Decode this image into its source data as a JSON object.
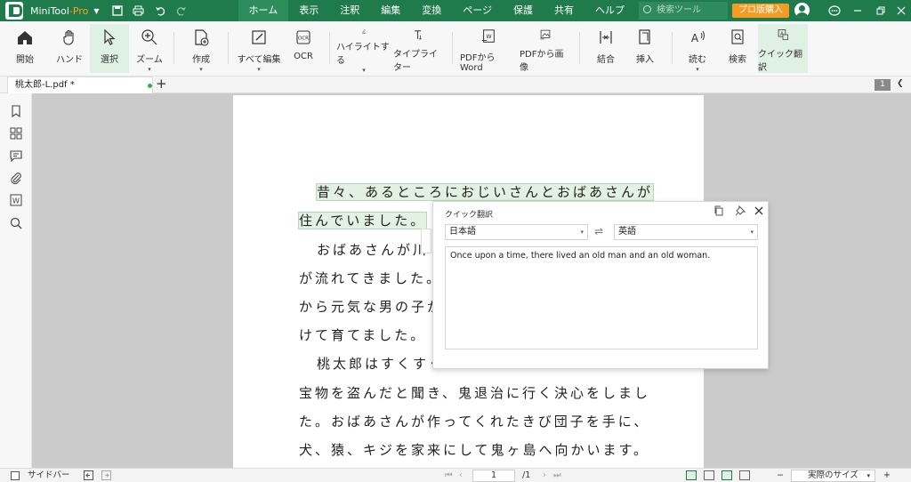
{
  "titlebar": {
    "app_name": "MiniTool",
    "app_suffix": "-Pro",
    "menu": [
      "ホーム",
      "表示",
      "注釈",
      "編集",
      "変換",
      "ページ",
      "保護",
      "共有",
      "ヘルプ"
    ],
    "search_placeholder": "検索ツール",
    "buy_label": "プロ版購入"
  },
  "ribbon": {
    "open": "開始",
    "hand": "ハンド",
    "select": "選択",
    "zoom": "ズーム",
    "create": "作成",
    "edit_all": "すべて編集",
    "ocr": "OCR",
    "highlight": "ハイライトする",
    "typewriter": "タイプライター",
    "pdf_to_word": "PDFからWord",
    "pdf_to_image": "PDFから画像",
    "merge": "結合",
    "insert": "挿入",
    "read": "読む",
    "search": "検索",
    "quick_translate": "クイック翻訳"
  },
  "tabs": {
    "doc_name": "桃太郎-L.pdf *",
    "page_badge": "1"
  },
  "document": {
    "lines": [
      "昔々、あるところにおじいさんとおばあさんが",
      "住んでいました。",
      "おばあさんが川",
      "が流れてきました。",
      "から元気な男の子が",
      "けて育てました。",
      "桃太郎はすくすく",
      "宝物を盗んだと聞き、鬼退治に行く決心をしまし",
      "た。おばあさんが作ってくれたきび団子を手に、",
      "犬、猿、キジを家来にして鬼ヶ島へ向かいます。"
    ]
  },
  "translate_panel": {
    "title": "クイック翻訳",
    "source_lang": "日本語",
    "target_lang": "英語",
    "result": "Once upon a time, there lived an old man and an old woman."
  },
  "statusbar": {
    "sidebar_label": "サイドバー",
    "page_current": "1",
    "page_total": "/1",
    "zoom_label": "実際のサイズ"
  },
  "colors": {
    "brand": "#1f7a4c",
    "accent": "#f59a23",
    "highlight": "#e3f1e3"
  }
}
